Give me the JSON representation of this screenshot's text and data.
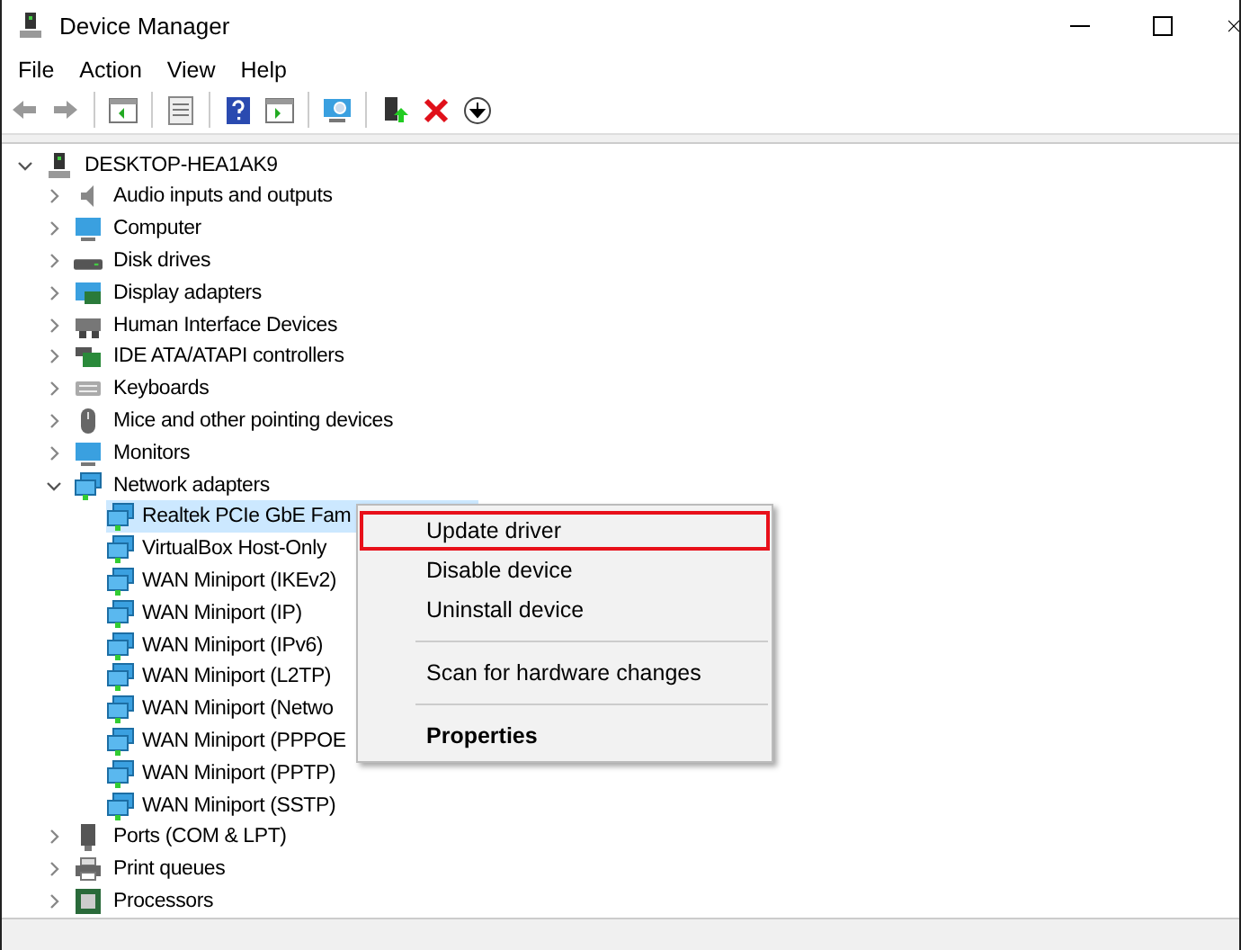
{
  "window": {
    "title": "Device Manager"
  },
  "menu_bar": [
    "File",
    "Action",
    "View",
    "Help"
  ],
  "tree": {
    "label": "DESKTOP-HEA1AK9",
    "expanded": true,
    "children": [
      {
        "label": "Audio inputs and outputs",
        "expanded": false
      },
      {
        "label": "Computer",
        "expanded": false
      },
      {
        "label": "Disk drives",
        "expanded": false
      },
      {
        "label": "Display adapters",
        "expanded": false
      },
      {
        "label": "Human Interface Devices",
        "expanded": false
      },
      {
        "label": "IDE ATA/ATAPI controllers",
        "expanded": false
      },
      {
        "label": "Keyboards",
        "expanded": false
      },
      {
        "label": "Mice and other pointing devices",
        "expanded": false
      },
      {
        "label": "Monitors",
        "expanded": false
      },
      {
        "label": "Network adapters",
        "expanded": true,
        "children": [
          {
            "label": "Realtek PCIe GbE Fam",
            "selected": true
          },
          {
            "label": "VirtualBox Host-Only",
            "selected": false
          },
          {
            "label": "WAN Miniport (IKEv2)",
            "selected": false
          },
          {
            "label": "WAN Miniport (IP)",
            "selected": false
          },
          {
            "label": "WAN Miniport (IPv6)",
            "selected": false
          },
          {
            "label": "WAN Miniport (L2TP)",
            "selected": false
          },
          {
            "label": "WAN Miniport (Netwo",
            "selected": false
          },
          {
            "label": "WAN Miniport (PPPOE",
            "selected": false
          },
          {
            "label": "WAN Miniport (PPTP)",
            "selected": false
          },
          {
            "label": "WAN Miniport (SSTP)",
            "selected": false
          }
        ]
      },
      {
        "label": "Ports (COM & LPT)",
        "expanded": false
      },
      {
        "label": "Print queues",
        "expanded": false
      },
      {
        "label": "Processors",
        "expanded": false
      }
    ]
  },
  "context_menu": [
    {
      "kind": "item",
      "label": "Update driver",
      "highlighted": true
    },
    {
      "kind": "item",
      "label": "Disable device",
      "highlighted": false
    },
    {
      "kind": "item",
      "label": "Uninstall device",
      "highlighted": false
    },
    {
      "kind": "separator"
    },
    {
      "kind": "item",
      "label": "Scan for hardware changes",
      "highlighted": false
    },
    {
      "kind": "separator"
    },
    {
      "kind": "default",
      "label": "Properties",
      "highlighted": false
    }
  ]
}
